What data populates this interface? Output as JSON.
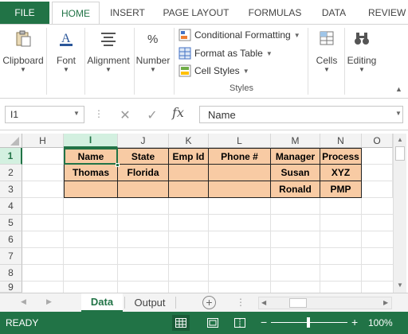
{
  "ribbon": {
    "tabs": [
      "FILE",
      "HOME",
      "INSERT",
      "PAGE LAYOUT",
      "FORMULAS",
      "DATA",
      "REVIEW"
    ],
    "active_tab": "HOME",
    "groups": {
      "clipboard": "Clipboard",
      "font": "Font",
      "alignment": "Alignment",
      "number": "Number",
      "cells": "Cells",
      "editing": "Editing"
    },
    "styles": {
      "conditional_formatting": "Conditional Formatting",
      "format_as_table": "Format as Table",
      "cell_styles": "Cell Styles",
      "group_label": "Styles"
    }
  },
  "formula_bar": {
    "name_box": "I1",
    "fx": "fx",
    "value": "Name"
  },
  "grid": {
    "columns": [
      "H",
      "I",
      "J",
      "K",
      "L",
      "M",
      "N",
      "O"
    ],
    "selected_column": "I",
    "rows": [
      "1",
      "2",
      "3",
      "4",
      "5",
      "6",
      "7",
      "8",
      "9"
    ],
    "selected_row": "1",
    "table": {
      "header": [
        "Name",
        "State",
        "Emp Id",
        "Phone #",
        "Manager",
        "Process"
      ],
      "row2": [
        "Thomas",
        "Florida",
        "",
        "",
        "Susan",
        "XYZ"
      ],
      "row3": [
        "",
        "",
        "",
        "",
        "Ronald",
        "PMP"
      ]
    },
    "table_fill_color": "#f8cba4"
  },
  "sheets": {
    "tabs": [
      "Data",
      "Output"
    ],
    "active": "Data"
  },
  "status": {
    "ready": "READY",
    "zoom": "100%",
    "zoom_minus": "−",
    "zoom_plus": "+"
  },
  "colors": {
    "accent": "#217346"
  }
}
